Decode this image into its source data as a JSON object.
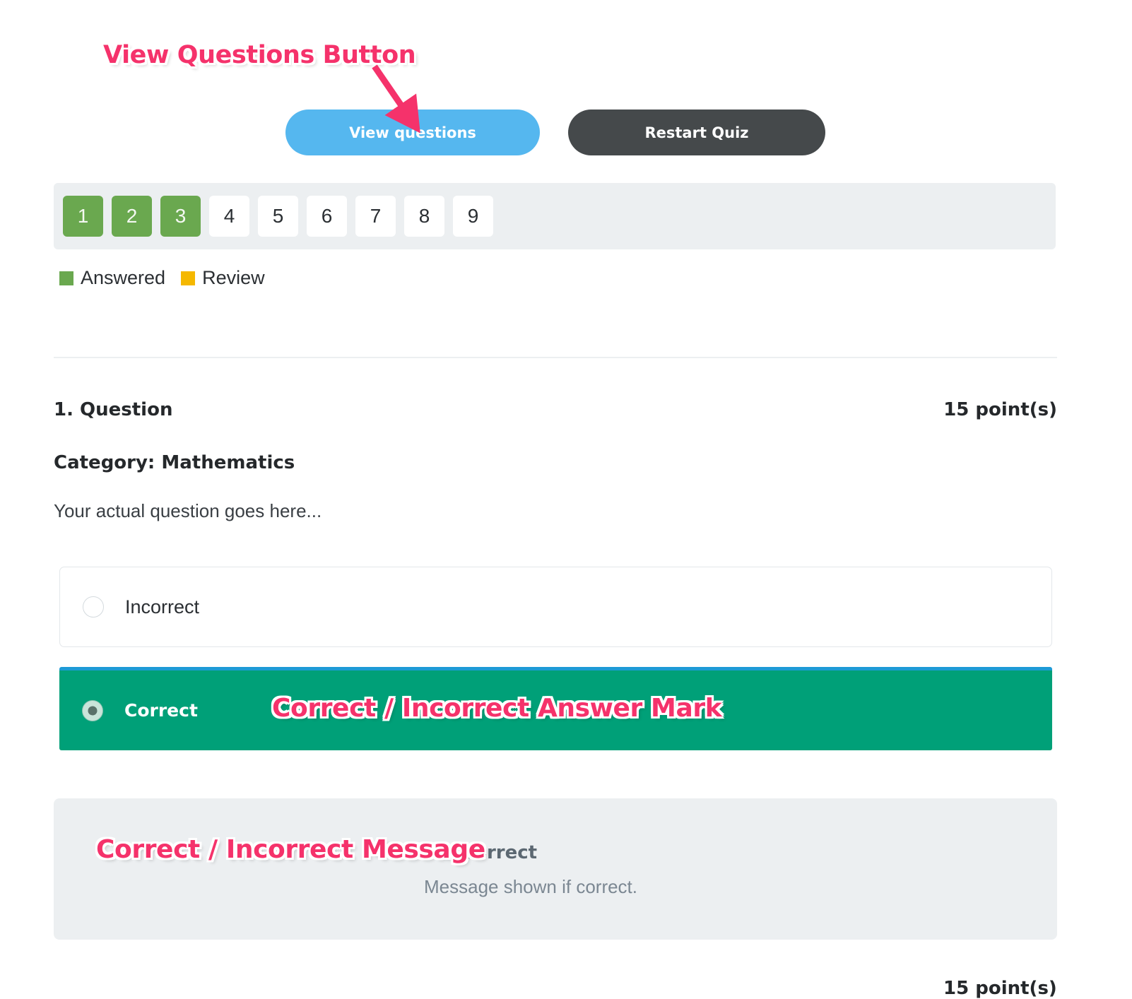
{
  "annotations": [
    {
      "id": "view-questions",
      "text": "View Questions Button"
    },
    {
      "id": "answer-mark",
      "text": "Correct / Incorrect Answer Mark"
    },
    {
      "id": "message",
      "text": "Correct / Incorrect Message"
    }
  ],
  "annotation_color": "#f5326b",
  "toolbar": {
    "view_questions_label": "View questions",
    "restart_quiz_label": "Restart Quiz",
    "view_questions_color": "#55b7ef",
    "restart_quiz_color": "#45494b"
  },
  "question_nav": {
    "items": [
      {
        "number": "1",
        "state": "answered"
      },
      {
        "number": "2",
        "state": "answered"
      },
      {
        "number": "3",
        "state": "answered"
      },
      {
        "number": "4",
        "state": "plain"
      },
      {
        "number": "5",
        "state": "plain"
      },
      {
        "number": "6",
        "state": "plain"
      },
      {
        "number": "7",
        "state": "plain"
      },
      {
        "number": "8",
        "state": "plain"
      },
      {
        "number": "9",
        "state": "plain"
      }
    ],
    "answered_color": "#6aa84f",
    "background": "#eceff1"
  },
  "legend": {
    "answered_label": "Answered",
    "review_label": "Review",
    "answered_color": "#6aa84f",
    "review_color": "#f5b800"
  },
  "question": {
    "title": "1. Question",
    "points": "15 point(s)",
    "category": "Category: Mathematics",
    "text": "Your actual question goes here...",
    "options": [
      {
        "label": "Incorrect",
        "selected": false,
        "state": "neutral"
      },
      {
        "label": "Correct",
        "selected": true,
        "state": "correct"
      }
    ],
    "correct_option_color": "#00a078",
    "correct_option_border_color": "#1d9ad6"
  },
  "feedback": {
    "title": "Correct",
    "body": "Message shown if correct.",
    "background": "#eceff1"
  },
  "next_question": {
    "points": "15 point(s)"
  }
}
